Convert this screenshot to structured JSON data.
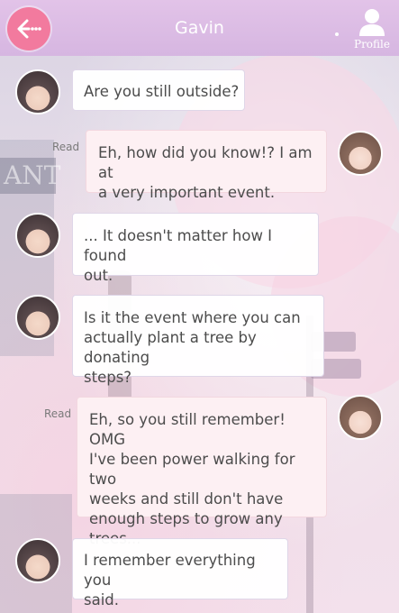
{
  "header": {
    "title": "Gavin",
    "profile_label": "Profile"
  },
  "background": {
    "sign_text": "ANT"
  },
  "messages": [
    {
      "from": "Gavin",
      "text": "Are you still outside?"
    },
    {
      "from": "me",
      "status": "Read",
      "lines": [
        "Eh, how did you know!? I am at",
        "a very important event."
      ]
    },
    {
      "from": "Gavin",
      "lines": [
        "... It doesn't matter how I found",
        "out."
      ]
    },
    {
      "from": "Gavin",
      "lines": [
        "Is it the event where you can",
        "actually plant a tree by donating",
        "steps?"
      ]
    },
    {
      "from": "me",
      "status": "Read",
      "lines": [
        "Eh, so you still remember! OMG",
        "I've been power walking for two",
        "weeks and still don't have",
        "enough steps to grow any",
        "trees..."
      ]
    },
    {
      "from": "Gavin",
      "lines": [
        "I remember everything you",
        "said."
      ]
    }
  ]
}
